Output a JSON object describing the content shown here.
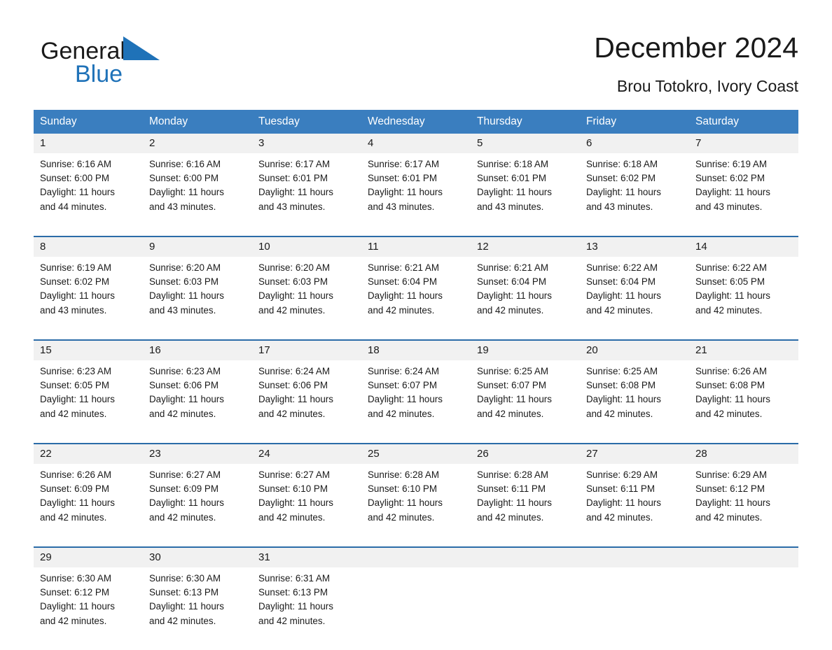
{
  "brand": {
    "word1": "General",
    "word2": "Blue",
    "triangle_icon": "triangle-icon",
    "accent_color": "#1f72b8"
  },
  "header": {
    "month_title": "December 2024",
    "location": "Brou Totokro, Ivory Coast"
  },
  "calendar": {
    "header_bg": "#3a7ebf",
    "date_band_bg": "#f1f1f1",
    "row_rule_color": "#2b6ca8",
    "weekdays": [
      "Sunday",
      "Monday",
      "Tuesday",
      "Wednesday",
      "Thursday",
      "Friday",
      "Saturday"
    ],
    "weeks": [
      [
        {
          "date": "1",
          "sunrise": "Sunrise: 6:16 AM",
          "sunset": "Sunset: 6:00 PM",
          "daylight_line1": "Daylight: 11 hours",
          "daylight_line2": "and 44 minutes."
        },
        {
          "date": "2",
          "sunrise": "Sunrise: 6:16 AM",
          "sunset": "Sunset: 6:00 PM",
          "daylight_line1": "Daylight: 11 hours",
          "daylight_line2": "and 43 minutes."
        },
        {
          "date": "3",
          "sunrise": "Sunrise: 6:17 AM",
          "sunset": "Sunset: 6:01 PM",
          "daylight_line1": "Daylight: 11 hours",
          "daylight_line2": "and 43 minutes."
        },
        {
          "date": "4",
          "sunrise": "Sunrise: 6:17 AM",
          "sunset": "Sunset: 6:01 PM",
          "daylight_line1": "Daylight: 11 hours",
          "daylight_line2": "and 43 minutes."
        },
        {
          "date": "5",
          "sunrise": "Sunrise: 6:18 AM",
          "sunset": "Sunset: 6:01 PM",
          "daylight_line1": "Daylight: 11 hours",
          "daylight_line2": "and 43 minutes."
        },
        {
          "date": "6",
          "sunrise": "Sunrise: 6:18 AM",
          "sunset": "Sunset: 6:02 PM",
          "daylight_line1": "Daylight: 11 hours",
          "daylight_line2": "and 43 minutes."
        },
        {
          "date": "7",
          "sunrise": "Sunrise: 6:19 AM",
          "sunset": "Sunset: 6:02 PM",
          "daylight_line1": "Daylight: 11 hours",
          "daylight_line2": "and 43 minutes."
        }
      ],
      [
        {
          "date": "8",
          "sunrise": "Sunrise: 6:19 AM",
          "sunset": "Sunset: 6:02 PM",
          "daylight_line1": "Daylight: 11 hours",
          "daylight_line2": "and 43 minutes."
        },
        {
          "date": "9",
          "sunrise": "Sunrise: 6:20 AM",
          "sunset": "Sunset: 6:03 PM",
          "daylight_line1": "Daylight: 11 hours",
          "daylight_line2": "and 43 minutes."
        },
        {
          "date": "10",
          "sunrise": "Sunrise: 6:20 AM",
          "sunset": "Sunset: 6:03 PM",
          "daylight_line1": "Daylight: 11 hours",
          "daylight_line2": "and 42 minutes."
        },
        {
          "date": "11",
          "sunrise": "Sunrise: 6:21 AM",
          "sunset": "Sunset: 6:04 PM",
          "daylight_line1": "Daylight: 11 hours",
          "daylight_line2": "and 42 minutes."
        },
        {
          "date": "12",
          "sunrise": "Sunrise: 6:21 AM",
          "sunset": "Sunset: 6:04 PM",
          "daylight_line1": "Daylight: 11 hours",
          "daylight_line2": "and 42 minutes."
        },
        {
          "date": "13",
          "sunrise": "Sunrise: 6:22 AM",
          "sunset": "Sunset: 6:04 PM",
          "daylight_line1": "Daylight: 11 hours",
          "daylight_line2": "and 42 minutes."
        },
        {
          "date": "14",
          "sunrise": "Sunrise: 6:22 AM",
          "sunset": "Sunset: 6:05 PM",
          "daylight_line1": "Daylight: 11 hours",
          "daylight_line2": "and 42 minutes."
        }
      ],
      [
        {
          "date": "15",
          "sunrise": "Sunrise: 6:23 AM",
          "sunset": "Sunset: 6:05 PM",
          "daylight_line1": "Daylight: 11 hours",
          "daylight_line2": "and 42 minutes."
        },
        {
          "date": "16",
          "sunrise": "Sunrise: 6:23 AM",
          "sunset": "Sunset: 6:06 PM",
          "daylight_line1": "Daylight: 11 hours",
          "daylight_line2": "and 42 minutes."
        },
        {
          "date": "17",
          "sunrise": "Sunrise: 6:24 AM",
          "sunset": "Sunset: 6:06 PM",
          "daylight_line1": "Daylight: 11 hours",
          "daylight_line2": "and 42 minutes."
        },
        {
          "date": "18",
          "sunrise": "Sunrise: 6:24 AM",
          "sunset": "Sunset: 6:07 PM",
          "daylight_line1": "Daylight: 11 hours",
          "daylight_line2": "and 42 minutes."
        },
        {
          "date": "19",
          "sunrise": "Sunrise: 6:25 AM",
          "sunset": "Sunset: 6:07 PM",
          "daylight_line1": "Daylight: 11 hours",
          "daylight_line2": "and 42 minutes."
        },
        {
          "date": "20",
          "sunrise": "Sunrise: 6:25 AM",
          "sunset": "Sunset: 6:08 PM",
          "daylight_line1": "Daylight: 11 hours",
          "daylight_line2": "and 42 minutes."
        },
        {
          "date": "21",
          "sunrise": "Sunrise: 6:26 AM",
          "sunset": "Sunset: 6:08 PM",
          "daylight_line1": "Daylight: 11 hours",
          "daylight_line2": "and 42 minutes."
        }
      ],
      [
        {
          "date": "22",
          "sunrise": "Sunrise: 6:26 AM",
          "sunset": "Sunset: 6:09 PM",
          "daylight_line1": "Daylight: 11 hours",
          "daylight_line2": "and 42 minutes."
        },
        {
          "date": "23",
          "sunrise": "Sunrise: 6:27 AM",
          "sunset": "Sunset: 6:09 PM",
          "daylight_line1": "Daylight: 11 hours",
          "daylight_line2": "and 42 minutes."
        },
        {
          "date": "24",
          "sunrise": "Sunrise: 6:27 AM",
          "sunset": "Sunset: 6:10 PM",
          "daylight_line1": "Daylight: 11 hours",
          "daylight_line2": "and 42 minutes."
        },
        {
          "date": "25",
          "sunrise": "Sunrise: 6:28 AM",
          "sunset": "Sunset: 6:10 PM",
          "daylight_line1": "Daylight: 11 hours",
          "daylight_line2": "and 42 minutes."
        },
        {
          "date": "26",
          "sunrise": "Sunrise: 6:28 AM",
          "sunset": "Sunset: 6:11 PM",
          "daylight_line1": "Daylight: 11 hours",
          "daylight_line2": "and 42 minutes."
        },
        {
          "date": "27",
          "sunrise": "Sunrise: 6:29 AM",
          "sunset": "Sunset: 6:11 PM",
          "daylight_line1": "Daylight: 11 hours",
          "daylight_line2": "and 42 minutes."
        },
        {
          "date": "28",
          "sunrise": "Sunrise: 6:29 AM",
          "sunset": "Sunset: 6:12 PM",
          "daylight_line1": "Daylight: 11 hours",
          "daylight_line2": "and 42 minutes."
        }
      ],
      [
        {
          "date": "29",
          "sunrise": "Sunrise: 6:30 AM",
          "sunset": "Sunset: 6:12 PM",
          "daylight_line1": "Daylight: 11 hours",
          "daylight_line2": "and 42 minutes."
        },
        {
          "date": "30",
          "sunrise": "Sunrise: 6:30 AM",
          "sunset": "Sunset: 6:13 PM",
          "daylight_line1": "Daylight: 11 hours",
          "daylight_line2": "and 42 minutes."
        },
        {
          "date": "31",
          "sunrise": "Sunrise: 6:31 AM",
          "sunset": "Sunset: 6:13 PM",
          "daylight_line1": "Daylight: 11 hours",
          "daylight_line2": "and 42 minutes."
        },
        {
          "date": "",
          "sunrise": "",
          "sunset": "",
          "daylight_line1": "",
          "daylight_line2": ""
        },
        {
          "date": "",
          "sunrise": "",
          "sunset": "",
          "daylight_line1": "",
          "daylight_line2": ""
        },
        {
          "date": "",
          "sunrise": "",
          "sunset": "",
          "daylight_line1": "",
          "daylight_line2": ""
        },
        {
          "date": "",
          "sunrise": "",
          "sunset": "",
          "daylight_line1": "",
          "daylight_line2": ""
        }
      ]
    ]
  }
}
